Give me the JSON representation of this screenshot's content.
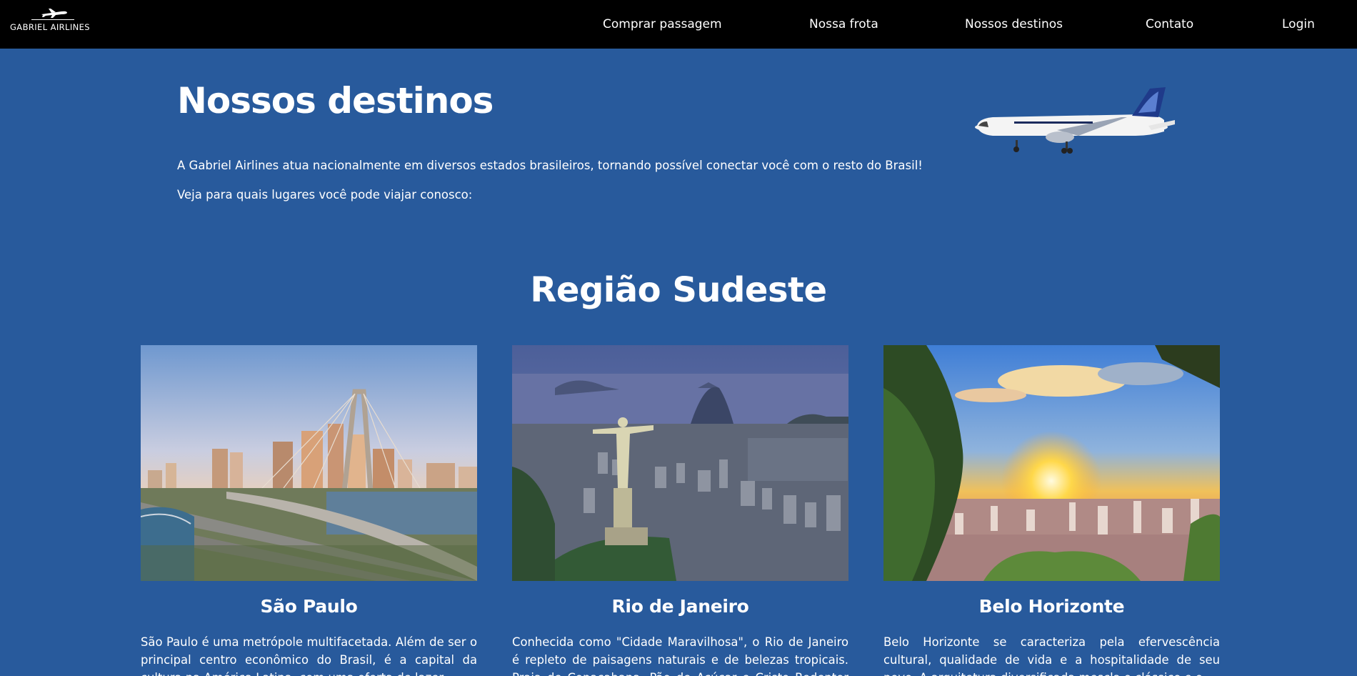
{
  "brand": {
    "name": "GABRIEL AIRLINES"
  },
  "nav": {
    "items": [
      {
        "label": "Comprar passagem"
      },
      {
        "label": "Nossa frota"
      },
      {
        "label": "Nossos destinos"
      },
      {
        "label": "Contato"
      },
      {
        "label": "Login"
      }
    ]
  },
  "hero": {
    "title": "Nossos destinos",
    "text1": "A Gabriel Airlines atua nacionalmente em diversos estados brasileiros, tornando possível conectar você com o resto do Brasil!",
    "text2": "Veja para quais lugares você pode viajar conosco:"
  },
  "region": {
    "title": "Região Sudeste"
  },
  "destinations": [
    {
      "name": "São Paulo",
      "description": "São Paulo é uma metrópole multifacetada. Além de ser o principal centro econômico do Brasil, é a capital da cultura na América Latina, com uma oferta de lazer..."
    },
    {
      "name": "Rio de Janeiro",
      "description": "Conhecida como \"Cidade Maravilhosa\", o Rio de Janeiro é repleto de paisagens naturais e de belezas tropicais. Praia de Copacabana, Pão de Açúcar e Cristo Redentor são só..."
    },
    {
      "name": "Belo Horizonte",
      "description": "Belo Horizonte se caracteriza pela efervescência cultural, qualidade de vida e a hospitalidade de seu povo. A arquitetura diversificada mescla o clássico e o..."
    }
  ],
  "colors": {
    "background": "#285a9c",
    "navbar": "#000000",
    "text": "#ffffff"
  }
}
